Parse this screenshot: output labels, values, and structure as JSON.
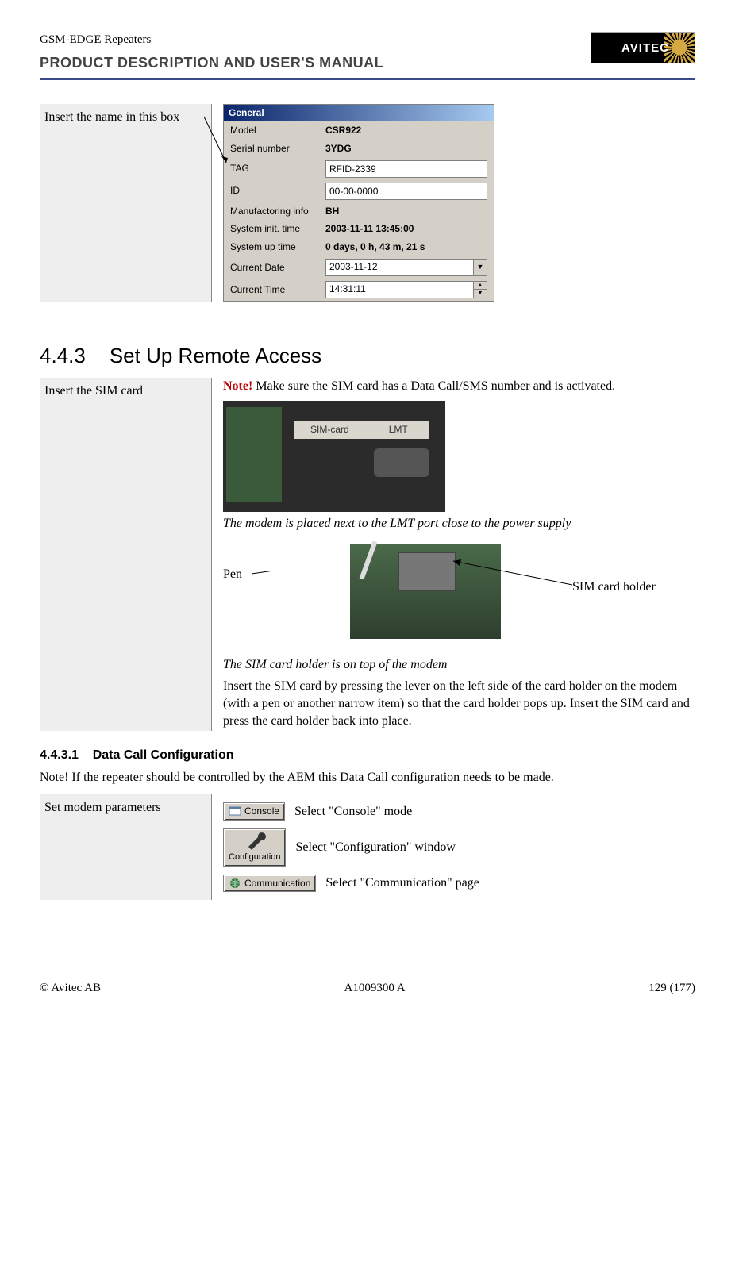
{
  "header": {
    "product_line": "GSM-EDGE Repeaters",
    "manual_title": "PRODUCT DESCRIPTION AND USER'S MANUAL",
    "logo_text": "AVITEC"
  },
  "insert_name": {
    "side_note": "Insert the name in this box",
    "panel": {
      "title": "General",
      "model_label": "Model",
      "model_value": "CSR922",
      "serial_label": "Serial number",
      "serial_value": "3YDG",
      "tag_label": "TAG",
      "tag_value": "RFID-2339",
      "id_label": "ID",
      "id_value": "00-00-0000",
      "manuf_label": "Manufactoring info",
      "manuf_value": "BH",
      "init_label": "System init. time",
      "init_value": "2003-11-11    13:45:00",
      "uptime_label": "System up time",
      "uptime_value": "0 days, 0 h, 43 m, 21 s",
      "curdate_label": "Current Date",
      "curdate_value": "2003-11-12",
      "curtime_label": "Current Time",
      "curtime_value": "14:31:11"
    }
  },
  "section_remote": {
    "number": "4.4.3",
    "title": "Set Up Remote Access"
  },
  "insert_sim": {
    "side_note": "Insert the SIM card",
    "note_prefix": "Note!",
    "note_text": " Make sure the SIM card has a Data Call/SMS number and is activated.",
    "photo_label_sim": "SIM-card",
    "photo_label_lmt": "LMT",
    "caption_modem": "The modem is placed  next to the LMT port close to the power supply",
    "pen_label": "Pen",
    "holder_label": "SIM card holder",
    "caption_holder": "The SIM card holder is on top of the modem",
    "instruction": "Insert the SIM card by pressing the lever on the left side of the card holder on the modem (with a pen or another narrow item) so that the card holder pops up. Insert the SIM card and press the card holder back into place."
  },
  "subsection_data_call": {
    "number": "4.4.3.1",
    "title": "Data Call Configuration",
    "note": "Note! If the repeater should be controlled by the AEM this Data Call configuration needs to be made."
  },
  "set_modem": {
    "side_note": "Set modem parameters",
    "console_btn": "Console",
    "console_text": "Select \"Console\" mode",
    "config_btn": "Configuration",
    "config_text": "Select \"Configuration\" window",
    "comm_btn": "Communication",
    "comm_text": "Select \"Communication\" page"
  },
  "footer": {
    "copyright": "© Avitec AB",
    "docno": "A1009300 A",
    "page": "129 (177)"
  }
}
